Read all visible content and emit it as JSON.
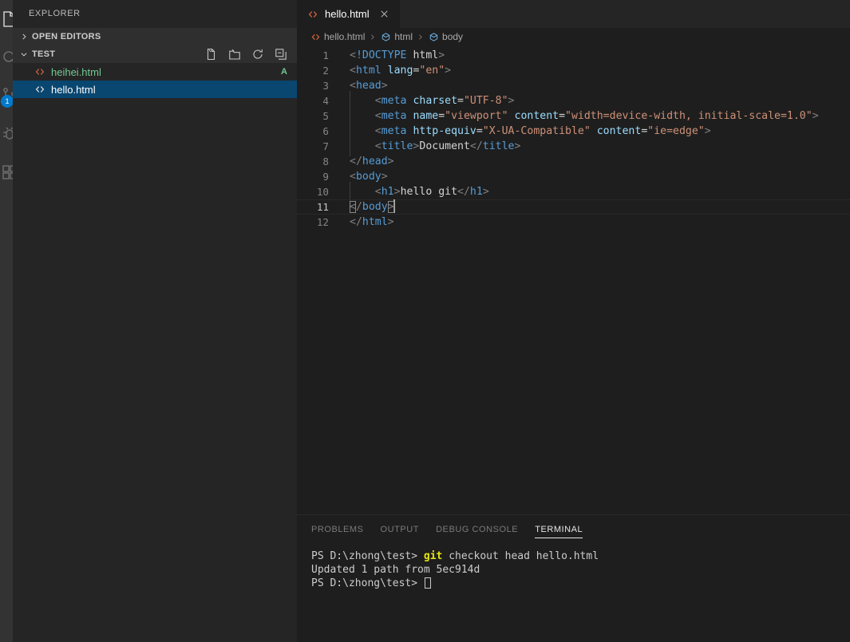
{
  "activity_bar": {
    "items": [
      {
        "name": "explorer",
        "icon": "files-icon",
        "active": true,
        "badge": ""
      },
      {
        "name": "search",
        "icon": "search-icon",
        "active": false,
        "badge": ""
      },
      {
        "name": "source-control",
        "icon": "source-control-icon",
        "active": false,
        "badge": "1"
      },
      {
        "name": "run-and-debug",
        "icon": "debug-icon",
        "active": false,
        "badge": ""
      },
      {
        "name": "extensions",
        "icon": "extensions-icon",
        "active": false,
        "badge": ""
      }
    ]
  },
  "sidebar": {
    "title": "EXPLORER",
    "sections": [
      {
        "label": "OPEN EDITORS",
        "expanded": false
      },
      {
        "label": "TEST",
        "expanded": true
      }
    ],
    "toolbar": [
      {
        "name": "new-file-icon",
        "tooltip": "New File"
      },
      {
        "name": "new-folder-icon",
        "tooltip": "New Folder"
      },
      {
        "name": "refresh-icon",
        "tooltip": "Refresh Explorer"
      },
      {
        "name": "collapse-all-icon",
        "tooltip": "Collapse Folders in Explorer"
      }
    ],
    "files": [
      {
        "name": "heihei.html",
        "icon": "html-file-icon",
        "selected": false,
        "git_status": "A"
      },
      {
        "name": "hello.html",
        "icon": "html-file-icon",
        "selected": true,
        "git_status": ""
      }
    ]
  },
  "editor": {
    "tabs": [
      {
        "label": "hello.html",
        "icon": "html-file-icon",
        "active": true,
        "close_icon": "close-icon"
      }
    ],
    "breadcrumbs": [
      {
        "label": "hello.html",
        "icon": "html-file-icon"
      },
      {
        "label": "html",
        "icon": "symbol-field-icon"
      },
      {
        "label": "body",
        "icon": "symbol-field-icon"
      }
    ],
    "active_line": 11,
    "lines": [
      {
        "num": "1",
        "indent": 0,
        "tokens": [
          {
            "t": "punc",
            "v": "<"
          },
          {
            "t": "doctype",
            "v": "!DOCTYPE"
          },
          {
            "t": "txt",
            "v": " "
          },
          {
            "t": "txt",
            "v": "html"
          },
          {
            "t": "punc",
            "v": ">"
          }
        ]
      },
      {
        "num": "2",
        "indent": 0,
        "tokens": [
          {
            "t": "punc",
            "v": "<"
          },
          {
            "t": "tag",
            "v": "html"
          },
          {
            "t": "txt",
            "v": " "
          },
          {
            "t": "attr",
            "v": "lang"
          },
          {
            "t": "eq",
            "v": "="
          },
          {
            "t": "str",
            "v": "\"en\""
          },
          {
            "t": "punc",
            "v": ">"
          }
        ]
      },
      {
        "num": "3",
        "indent": 0,
        "tokens": [
          {
            "t": "punc",
            "v": "<"
          },
          {
            "t": "tag",
            "v": "head"
          },
          {
            "t": "punc",
            "v": ">"
          }
        ]
      },
      {
        "num": "4",
        "indent": 1,
        "tokens": [
          {
            "t": "punc",
            "v": "<"
          },
          {
            "t": "tag",
            "v": "meta"
          },
          {
            "t": "txt",
            "v": " "
          },
          {
            "t": "attr",
            "v": "charset"
          },
          {
            "t": "eq",
            "v": "="
          },
          {
            "t": "str",
            "v": "\"UTF-8\""
          },
          {
            "t": "punc",
            "v": ">"
          }
        ]
      },
      {
        "num": "5",
        "indent": 1,
        "tokens": [
          {
            "t": "punc",
            "v": "<"
          },
          {
            "t": "tag",
            "v": "meta"
          },
          {
            "t": "txt",
            "v": " "
          },
          {
            "t": "attr",
            "v": "name"
          },
          {
            "t": "eq",
            "v": "="
          },
          {
            "t": "str",
            "v": "\"viewport\""
          },
          {
            "t": "txt",
            "v": " "
          },
          {
            "t": "attr",
            "v": "content"
          },
          {
            "t": "eq",
            "v": "="
          },
          {
            "t": "str",
            "v": "\"width=device-width, initial-scale=1.0\""
          },
          {
            "t": "punc",
            "v": ">"
          }
        ]
      },
      {
        "num": "6",
        "indent": 1,
        "tokens": [
          {
            "t": "punc",
            "v": "<"
          },
          {
            "t": "tag",
            "v": "meta"
          },
          {
            "t": "txt",
            "v": " "
          },
          {
            "t": "attr",
            "v": "http-equiv"
          },
          {
            "t": "eq",
            "v": "="
          },
          {
            "t": "str",
            "v": "\"X-UA-Compatible\""
          },
          {
            "t": "txt",
            "v": " "
          },
          {
            "t": "attr",
            "v": "content"
          },
          {
            "t": "eq",
            "v": "="
          },
          {
            "t": "str",
            "v": "\"ie=edge\""
          },
          {
            "t": "punc",
            "v": ">"
          }
        ]
      },
      {
        "num": "7",
        "indent": 1,
        "tokens": [
          {
            "t": "punc",
            "v": "<"
          },
          {
            "t": "tag",
            "v": "title"
          },
          {
            "t": "punc",
            "v": ">"
          },
          {
            "t": "txt",
            "v": "Document"
          },
          {
            "t": "punc",
            "v": "</"
          },
          {
            "t": "tag",
            "v": "title"
          },
          {
            "t": "punc",
            "v": ">"
          }
        ]
      },
      {
        "num": "8",
        "indent": 0,
        "tokens": [
          {
            "t": "punc",
            "v": "</"
          },
          {
            "t": "tag",
            "v": "head"
          },
          {
            "t": "punc",
            "v": ">"
          }
        ]
      },
      {
        "num": "9",
        "indent": 0,
        "tokens": [
          {
            "t": "punc",
            "v": "<"
          },
          {
            "t": "tag",
            "v": "body"
          },
          {
            "t": "punc",
            "v": ">"
          }
        ]
      },
      {
        "num": "10",
        "indent": 1,
        "tokens": [
          {
            "t": "punc",
            "v": "<"
          },
          {
            "t": "tag",
            "v": "h1"
          },
          {
            "t": "punc",
            "v": ">"
          },
          {
            "t": "txt",
            "v": "hello git"
          },
          {
            "t": "punc",
            "v": "</"
          },
          {
            "t": "tag",
            "v": "h1"
          },
          {
            "t": "punc",
            "v": ">"
          }
        ]
      },
      {
        "num": "11",
        "indent": 0,
        "tokens": [
          {
            "t": "punc",
            "v": "<",
            "bracket": true
          },
          {
            "t": "punc",
            "v": "/"
          },
          {
            "t": "tag",
            "v": "body"
          },
          {
            "t": "punc",
            "v": ">",
            "bracket": true,
            "caret": true
          }
        ]
      },
      {
        "num": "12",
        "indent": 0,
        "tokens": [
          {
            "t": "punc",
            "v": "</"
          },
          {
            "t": "tag",
            "v": "html"
          },
          {
            "t": "punc",
            "v": ">"
          }
        ]
      }
    ]
  },
  "panel": {
    "tabs": [
      {
        "label": "PROBLEMS",
        "active": false
      },
      {
        "label": "OUTPUT",
        "active": false
      },
      {
        "label": "DEBUG CONSOLE",
        "active": false
      },
      {
        "label": "TERMINAL",
        "active": true
      }
    ],
    "terminal_lines": [
      {
        "prompt": "PS D:\\zhong\\test> ",
        "command_highlight": "git",
        "command_rest": " checkout head hello.html",
        "output": ""
      },
      {
        "prompt": "",
        "command_highlight": "",
        "command_rest": "",
        "output": "Updated 1 path from 5ec914d"
      },
      {
        "prompt": "PS D:\\zhong\\test> ",
        "command_highlight": "",
        "command_rest": "",
        "output": "",
        "cursor": true
      }
    ]
  },
  "colors": {
    "activity_bar_bg": "#333333",
    "sidebar_bg": "#252526",
    "editor_bg": "#1e1e1e",
    "selection_blue": "#094771",
    "git_added_green": "#73c991",
    "badge_blue": "#007acc",
    "tag_blue": "#569cd6",
    "attr_lightblue": "#9cdcfe",
    "string_orange": "#ce9178",
    "terminal_yellow": "#e5e510"
  }
}
